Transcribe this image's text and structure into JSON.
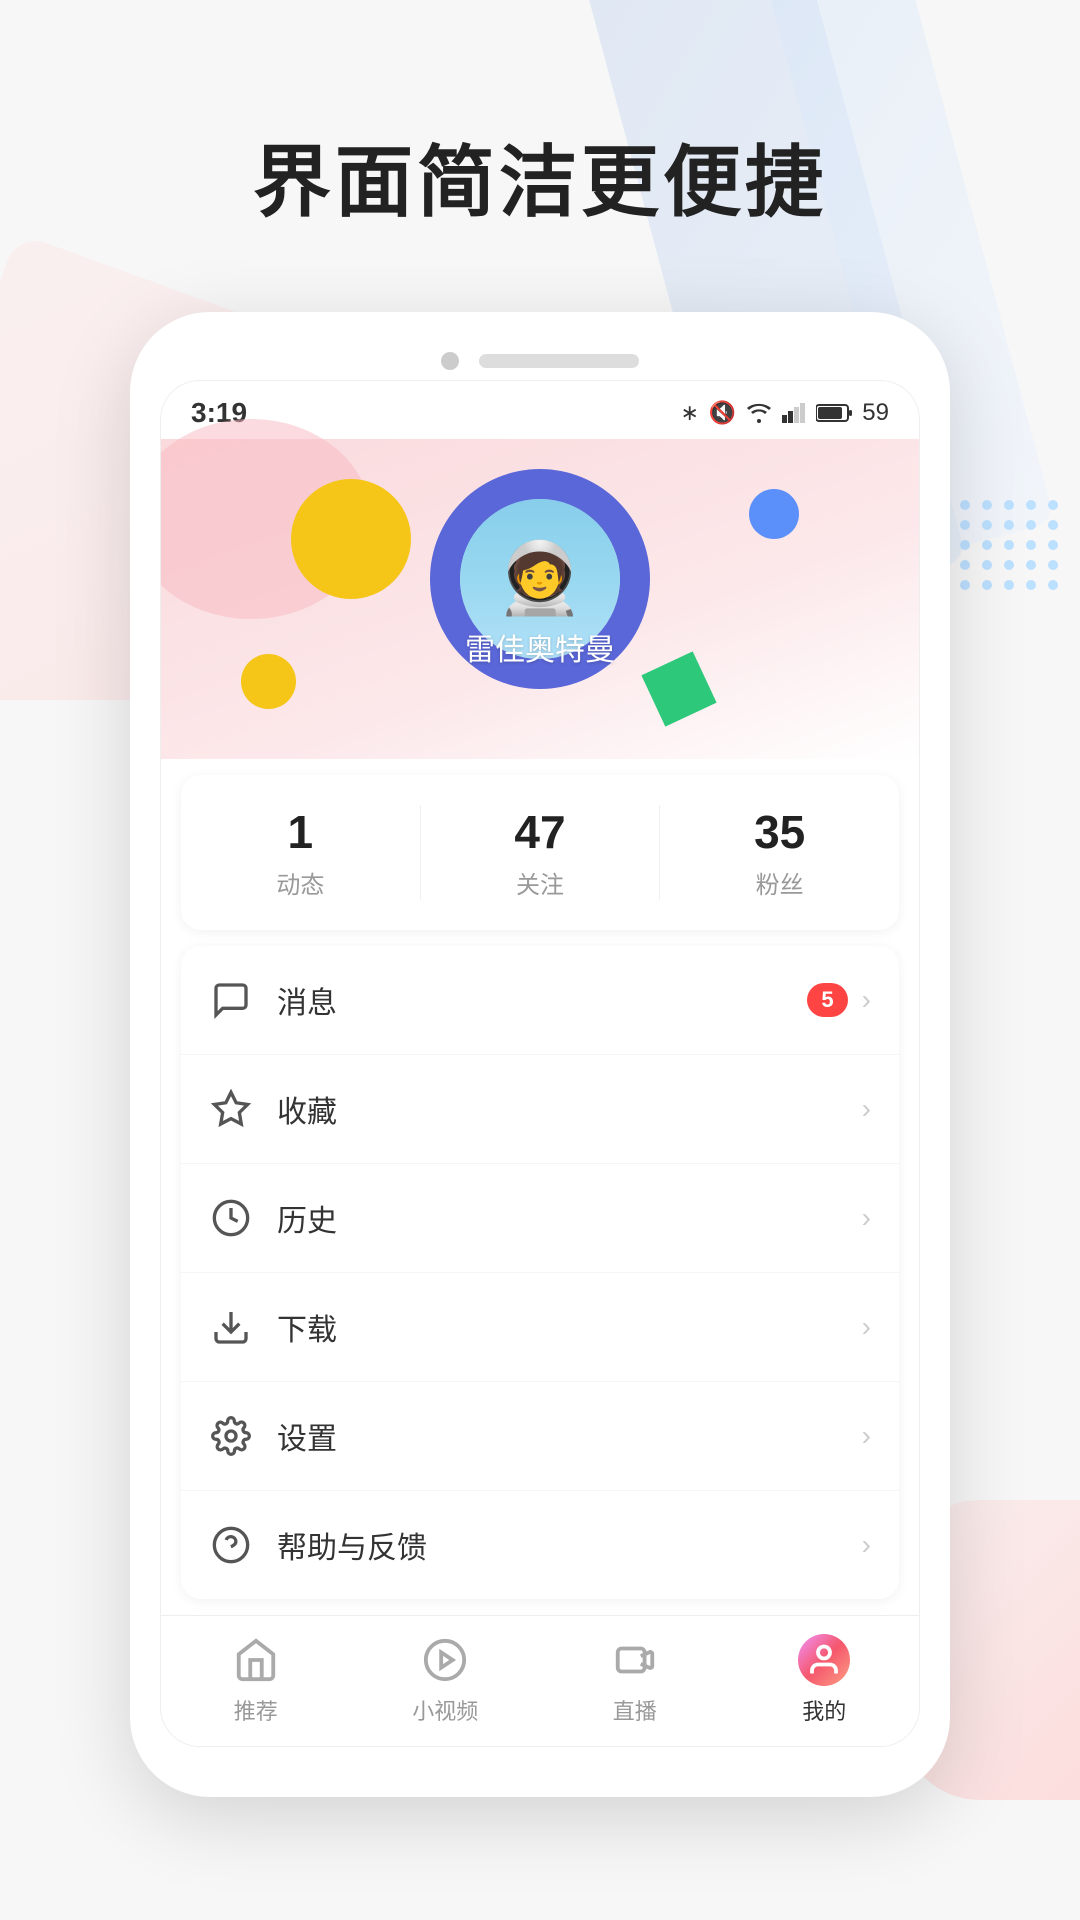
{
  "page": {
    "title": "界面简洁更便捷",
    "bg_slashes": true
  },
  "status_bar": {
    "time": "3:19",
    "battery_percent": "59"
  },
  "profile": {
    "name": "雷佳奥特曼",
    "avatar_emoji": "🧑‍🚀"
  },
  "stats": [
    {
      "number": "1",
      "label": "动态"
    },
    {
      "number": "47",
      "label": "关注"
    },
    {
      "number": "35",
      "label": "粉丝"
    }
  ],
  "menu_items": [
    {
      "id": "message",
      "icon": "chat",
      "label": "消息",
      "badge": "5",
      "has_badge": true
    },
    {
      "id": "favorites",
      "icon": "star",
      "label": "收藏",
      "badge": null,
      "has_badge": false
    },
    {
      "id": "history",
      "icon": "clock",
      "label": "历史",
      "badge": null,
      "has_badge": false
    },
    {
      "id": "download",
      "icon": "download",
      "label": "下载",
      "badge": null,
      "has_badge": false
    },
    {
      "id": "settings",
      "icon": "settings",
      "label": "设置",
      "badge": null,
      "has_badge": false
    },
    {
      "id": "help",
      "icon": "help",
      "label": "帮助与反馈",
      "badge": null,
      "has_badge": false
    }
  ],
  "bottom_nav": [
    {
      "id": "recommend",
      "label": "推荐",
      "active": false
    },
    {
      "id": "short-video",
      "label": "小视频",
      "active": false
    },
    {
      "id": "live",
      "label": "直播",
      "active": false
    },
    {
      "id": "my",
      "label": "我的",
      "active": true
    }
  ]
}
